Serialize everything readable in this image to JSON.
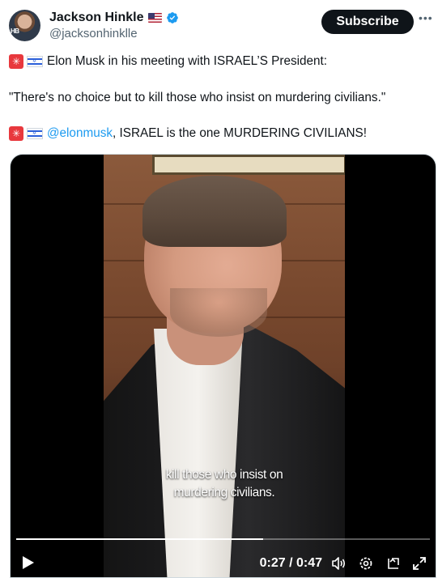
{
  "author": {
    "display_name": "Jackson Hinkle",
    "handle": "@jacksonhinklle",
    "avatar_badge": "HB",
    "verified": true,
    "flag": "us-flag-icon"
  },
  "header": {
    "subscribe_label": "Subscribe",
    "more_icon": "more-icon"
  },
  "tweet": {
    "line1_text": "Elon Musk in his meeting with ISRAEL’S President:",
    "line2_text": "\"There's no choice but to kill those who insist on murdering civilians.\"",
    "line3_mention": "@elonmusk",
    "line3_text": ", ISRAEL is the one MURDERING CIVILIANS!",
    "emoji": [
      "rotating-light-emoji",
      "israel-flag-emoji"
    ]
  },
  "video": {
    "subtitle_line1": "kill those who insist on",
    "subtitle_line2": "murdering civilians.",
    "time_display": "0:27 / 0:47",
    "progress_fraction": 0.596,
    "controls": [
      "play-icon",
      "volume-icon",
      "settings-icon",
      "pip-icon",
      "fullscreen-icon"
    ]
  },
  "colors": {
    "accent": "#1d9bf0",
    "text": "#0f1419",
    "secondary_text": "#536471",
    "subscribe_bg": "#0f1419"
  }
}
